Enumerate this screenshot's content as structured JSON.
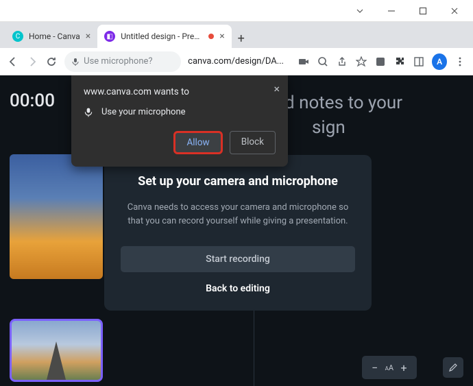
{
  "tabs": {
    "inactive": {
      "title": "Home - Canva"
    },
    "active": {
      "title": "Untitled design - Presen"
    }
  },
  "toolbar": {
    "mic_hint": "Use microphone?",
    "url": "canva.com/design/DA...",
    "avatar_letter": "A"
  },
  "content": {
    "timer": "00:00",
    "bg_text_line1": "d notes to your",
    "bg_text_line2": "sign"
  },
  "permission": {
    "title": "www.canva.com wants to",
    "mic_line": "Use your microphone",
    "allow": "Allow",
    "block": "Block"
  },
  "modal": {
    "heading": "Set up your camera and microphone",
    "body": "Canva needs to access your camera and microphone so that you can record yourself while giving a presentation.",
    "start": "Start recording",
    "back": "Back to editing"
  },
  "bottombar": {
    "text_size_label": "AA"
  }
}
